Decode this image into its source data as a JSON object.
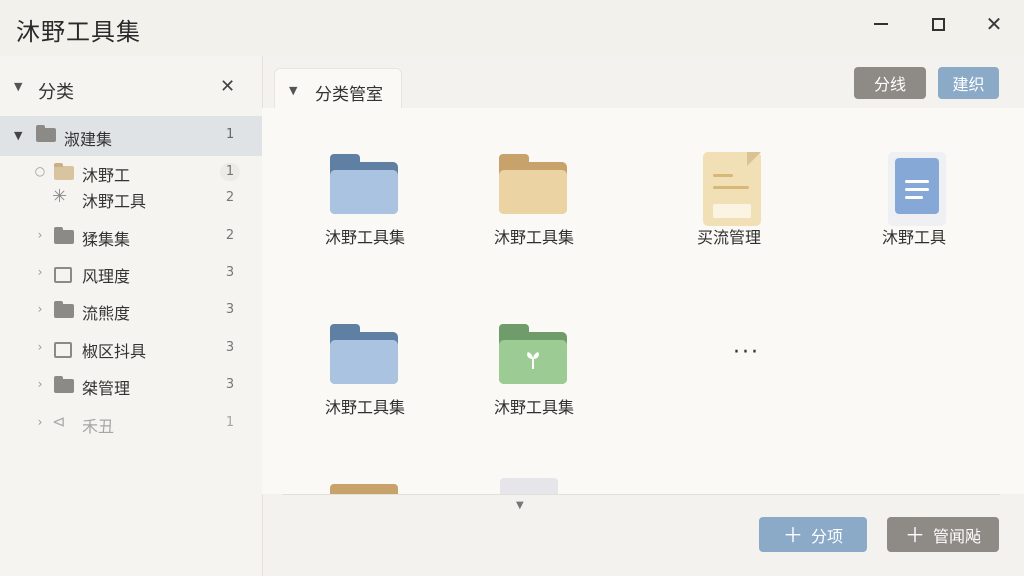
{
  "window": {
    "title": "沐野工具集",
    "controls": {
      "minimize": "minimize-icon",
      "maximize": "maximize-icon",
      "close": "close-icon"
    }
  },
  "sidebar": {
    "header_label": "分类",
    "close_glyph": "✕",
    "root": {
      "label": "淑建集",
      "count": "1"
    },
    "items": [
      {
        "lead": "○",
        "icon": "folder-tan",
        "label": "沐野工",
        "count": "1"
      },
      {
        "lead": "",
        "icon": "asterisk",
        "label": "沐野工具",
        "count": "2"
      },
      {
        "lead": "›",
        "icon": "folder",
        "label": "猱集集",
        "count": "2"
      },
      {
        "lead": "›",
        "icon": "folder-outline",
        "label": "风理度",
        "count": "3"
      },
      {
        "lead": "›",
        "icon": "folder",
        "label": "流熊度",
        "count": "3"
      },
      {
        "lead": "›",
        "icon": "folder-box",
        "label": "椒区抖具",
        "count": "3"
      },
      {
        "lead": "›",
        "icon": "folder",
        "label": "桀管理",
        "count": "3"
      },
      {
        "lead": "›",
        "icon": "tag",
        "label": "禾丑",
        "count": "1"
      }
    ]
  },
  "main": {
    "tab_label": "分类管室",
    "buttons": {
      "category": "分线",
      "create": "建织",
      "add": "分项",
      "manage": "管闻飐"
    },
    "grid": [
      {
        "type": "folder-blue",
        "label": "沐野工具集"
      },
      {
        "type": "folder-tan",
        "label": "沐野工具集"
      },
      {
        "type": "doc-tan",
        "label": "买流管理"
      },
      {
        "type": "doc-blue",
        "label": "沐野工具"
      },
      {
        "type": "folder-blue",
        "label": "沐野工具集"
      },
      {
        "type": "folder-green",
        "label": "沐野工具集"
      }
    ],
    "more": "···"
  }
}
